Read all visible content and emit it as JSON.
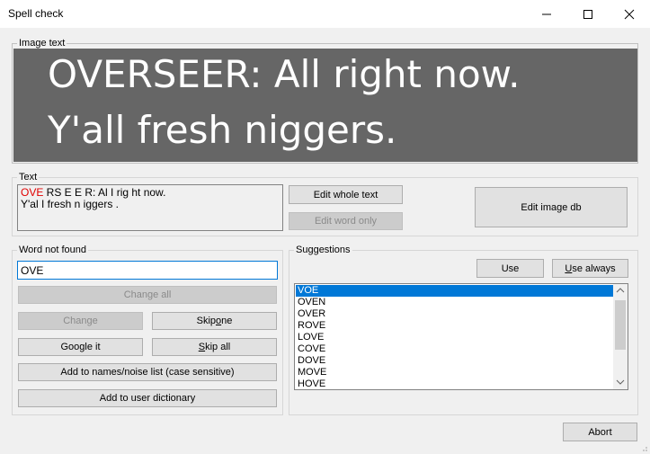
{
  "window": {
    "title": "Spell check",
    "minimize_icon": "minimize-icon",
    "maximize_icon": "maximize-icon",
    "close_icon": "close-icon"
  },
  "image_text": {
    "group_label": "Image text",
    "line1": "OVERSEER: All right now.",
    "line2": "Y'all fresh niggers."
  },
  "text": {
    "group_label": "Text",
    "line1_error": "OVE",
    "line1_rest": " RS E E R: Al I rig ht now.",
    "line2": "Y'al I fresh n iggers ."
  },
  "buttons": {
    "edit_whole_text": "Edit whole text",
    "edit_word_only": "Edit word only",
    "edit_image_db": "Edit image db",
    "change_all": "Change all",
    "change": "Change",
    "skip_one_pre": "Skip ",
    "skip_one_u": "o",
    "skip_one_post": "ne",
    "google_it": "Google it",
    "skip_all_u": "S",
    "skip_all_post": "kip all",
    "add_names": "Add to names/noise list (case sensitive)",
    "add_user_dict": "Add to user dictionary",
    "use": "Use",
    "use_always_u": "U",
    "use_always_post": "se always",
    "abort": "Abort"
  },
  "word_not_found": {
    "group_label": "Word not found",
    "value": "OVE"
  },
  "suggestions": {
    "group_label": "Suggestions",
    "items": [
      "VOE",
      "OVEN",
      "OVER",
      "ROVE",
      "LOVE",
      "COVE",
      "DOVE",
      "MOVE",
      "HOVE"
    ],
    "selected_index": 0
  },
  "colors": {
    "error_red": "#e00000",
    "selection_blue": "#0078d7",
    "image_bg": "#666666"
  }
}
